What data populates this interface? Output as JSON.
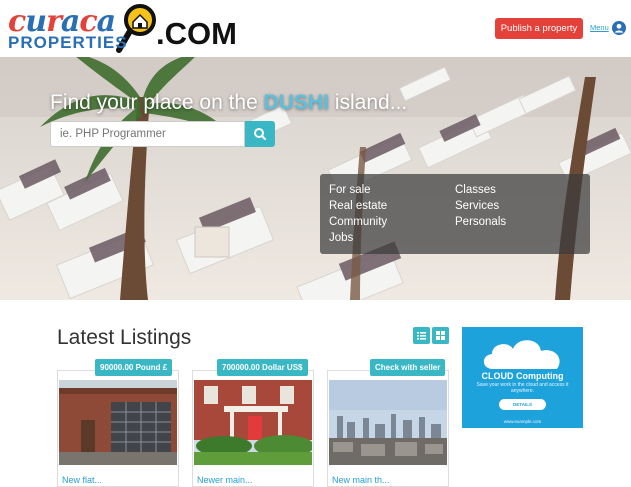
{
  "brand": {
    "logo_word1": "curacao",
    "logo_word2": "PROPERTIES",
    "logo_suffix": ".COM",
    "colors": {
      "red": "#e4413a",
      "blue": "#2a6fb5",
      "accent": "#3ab7c5"
    }
  },
  "header": {
    "publish_label": "Publish a property",
    "menu_label": "Menu",
    "user_icon": "user-circle-icon"
  },
  "hero": {
    "title_before": "Find your place on the ",
    "title_highlight": "DUSHI",
    "title_after": " island...",
    "search_placeholder": "ie. PHP Programmer",
    "search_icon": "search-icon",
    "categories_left": [
      "For sale",
      "Real estate",
      "Community",
      "Jobs"
    ],
    "categories_right": [
      "Classes",
      "Services",
      "Personals"
    ]
  },
  "listings": {
    "title": "Latest Listings",
    "view_icons": [
      "list-view-icon",
      "grid-view-icon"
    ],
    "cards": [
      {
        "price": "90000.00 Pound £",
        "caption": "New flat...",
        "photo": "garage-house-photo"
      },
      {
        "price": "700000.00 Dollar US$",
        "caption": "Newer main...",
        "photo": "red-house-photo"
      },
      {
        "price": "Check with seller",
        "caption": "New main th...",
        "photo": "city-skyline-photo"
      }
    ]
  },
  "ad": {
    "title": "CLOUD Computing",
    "subtitle": "Save your work in the cloud and access it anywhere.",
    "button": "DETAILS",
    "footer": "www.example.com",
    "icon": "cloud-icon"
  }
}
